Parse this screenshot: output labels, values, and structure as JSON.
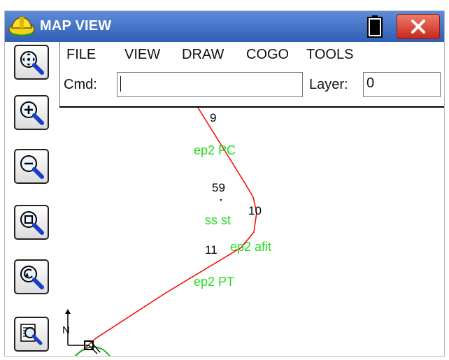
{
  "window": {
    "title": "MAP VIEW",
    "icons": [
      "hardhat-app-icon",
      "battery-icon",
      "close-icon"
    ]
  },
  "menu": {
    "items": [
      "FILE",
      "VIEW",
      "DRAW",
      "COGO",
      "TOOLS"
    ]
  },
  "command_bar": {
    "cmd_label": "Cmd:",
    "cmd_value": "",
    "layer_label": "Layer:",
    "layer_value": "0"
  },
  "toolbar": {
    "tools": [
      "zoom-extents-icon",
      "zoom-in-icon",
      "zoom-out-icon",
      "zoom-window-icon",
      "zoom-previous-icon",
      "map-details-icon"
    ]
  },
  "map": {
    "point_labels": [
      "9",
      "59",
      "10",
      "11"
    ],
    "feature_labels": [
      "ep2 PC",
      "ss st",
      "ep2 afit",
      "ep2 PT"
    ],
    "north_label": "N",
    "colors": {
      "alignment_line": "#ff0000",
      "feature_text": "#22dd22",
      "point_text": "#000000",
      "titlebar": "#3a6cc4",
      "close_button": "#d8372a"
    }
  }
}
